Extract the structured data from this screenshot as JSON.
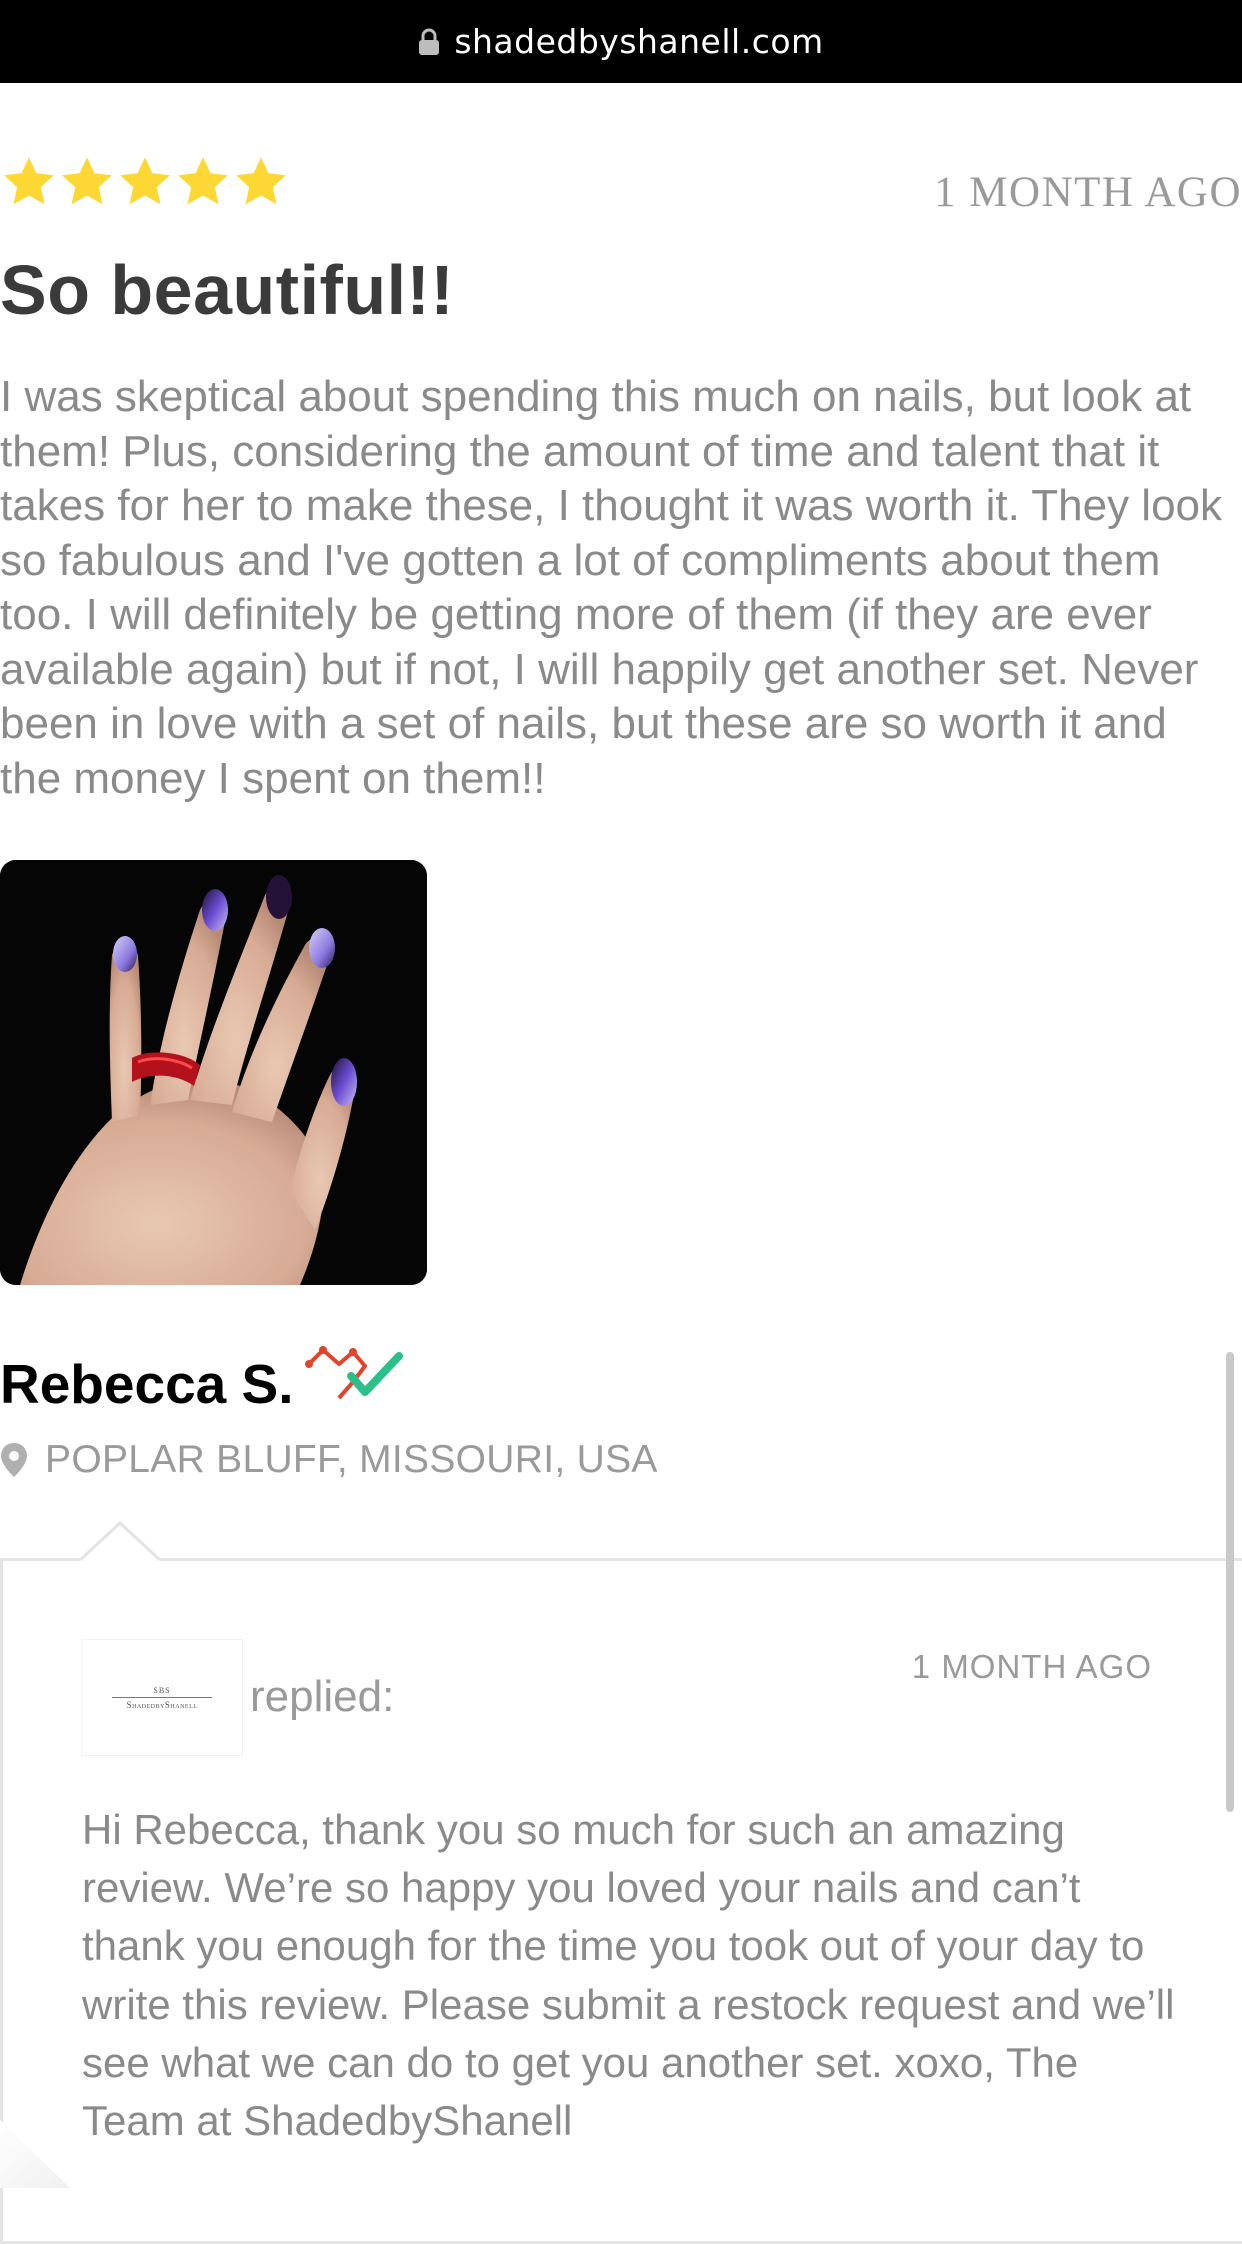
{
  "browser": {
    "domain": "shadedbyshanell.com",
    "lock_icon": "lock-icon"
  },
  "review": {
    "rating": 5,
    "rating_max": 5,
    "star_color": "#fdd835",
    "date": "1 MONTH AGO",
    "title": "So beautiful!!",
    "body": "I was skeptical about spending this much on nails, but look at them! Plus, considering the amount of time and talent that it takes for her to make these, I thought it was worth it. They look so fabulous and I've gotten a lot of compliments about them too. I will definitely be getting more of them (if they are ever available again) but if not, I will happily get another set. Never been in love with a set of nails, but these are so worth it and the money I spent on them!!"
  },
  "reviewer": {
    "name": "Rebecca S.",
    "badge_icon": "verified-buyer-icon",
    "location_icon": "map-pin-icon",
    "location": "POPLAR BLUFF, MISSOURI, USA"
  },
  "reply": {
    "logo_monogram": "SBS",
    "logo_text": "ShadedbyShanell",
    "label": "replied:",
    "date": "1 MONTH AGO",
    "body": "Hi Rebecca, thank you so much for such an amazing review. We’re so happy you loved your nails and can’t thank you enough for the time you took out of your day to write this review. Please submit a restock request and we’ll see what we can do to get you another set. xoxo, The Team at ShadedbyShanell"
  },
  "colors": {
    "title": "#3b3b3b",
    "body_text": "#8a8a8a",
    "muted": "#9a9a9a",
    "check_green": "#2bbf8a",
    "badge_red": "#e0452b"
  }
}
